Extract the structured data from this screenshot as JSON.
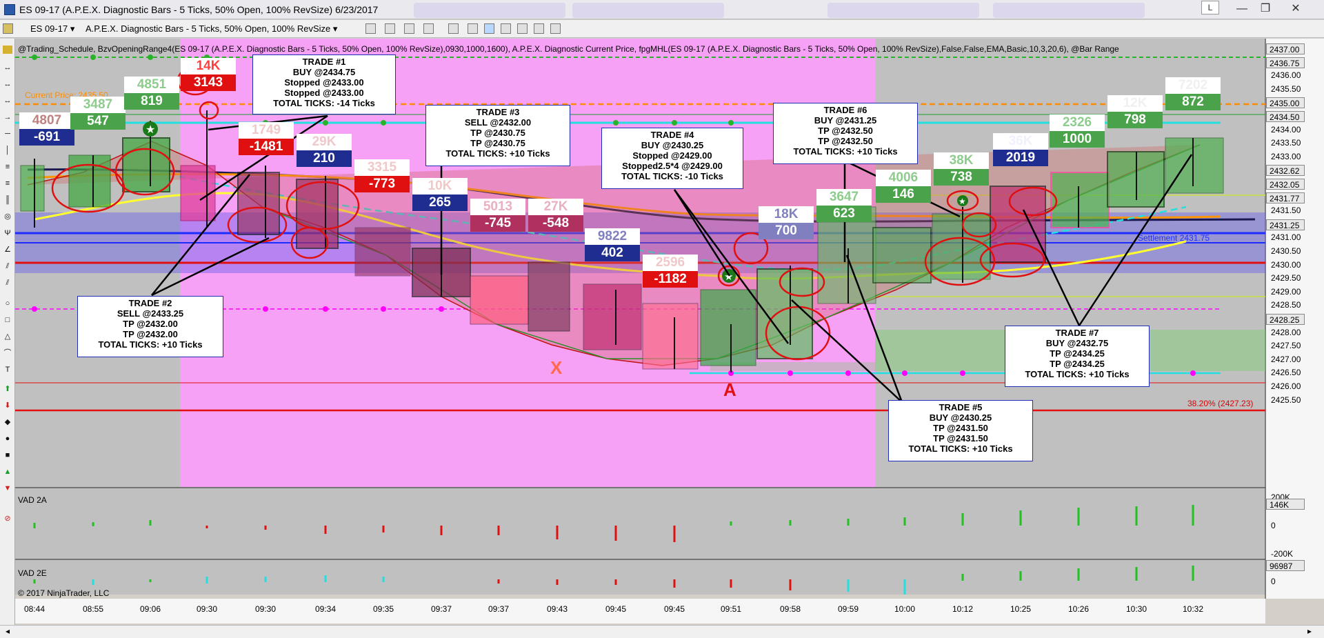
{
  "window": {
    "title": "ES 09-17 (A.P.E.X. Diagnostic Bars - 5 Ticks, 50% Open, 100% RevSize)  6/23/2017",
    "user_button": "L",
    "minimize": "—",
    "restore": "❐",
    "close": "✕"
  },
  "toolbar": {
    "instrument": "ES 09-17",
    "bars_type": "A.P.E.X. Diagnostic Bars - 5 Ticks, 50% Open, 100% RevSize"
  },
  "chart": {
    "indicator_line": "@Trading_Schedule, BzvOpeningRange4(ES 09-17 (A.P.E.X. Diagnostic Bars - 5 Ticks, 50% Open, 100% RevSize),0930,1000,1600), A.P.E.X. Diagnostic Current Price, fpgMHL(ES 09-17 (A.P.E.X. Diagnostic Bars - 5 Ticks, 50% Open, 100% RevSize),False,False,EMA,Basic,10,3,20,6), @Bar Range",
    "current_price": "Current Price: 2435.50",
    "settlement": "Settlement 2431.75",
    "fib": "38.20% (2427.23)",
    "panel_a": "VAD 2A",
    "panel_b": "VAD 2E",
    "copyright": "© 2017 NinjaTrader, LLC",
    "marker_x": "X",
    "marker_a": "A"
  },
  "price_axis": [
    "2437.00",
    "2436.75",
    "2436.00",
    "2435.50",
    "2435.00",
    "2434.50",
    "2434.00",
    "2433.50",
    "2433.00",
    "2432.62",
    "2432.05",
    "2431.77",
    "2431.50",
    "2431.25",
    "2431.00",
    "2430.50",
    "2430.00",
    "2429.50",
    "2429.00",
    "2428.50",
    "2428.25",
    "2428.00",
    "2427.50",
    "2427.00",
    "2426.50",
    "2426.00",
    "2425.50"
  ],
  "price_axis_tags": [
    "2437.00",
    "2436.75",
    "2435.00",
    "2434.50",
    "2432.62",
    "2432.05",
    "2431.77",
    "2431.25",
    "2428.25"
  ],
  "vad2a_axis": [
    "200K",
    "146K",
    "0",
    "-200K"
  ],
  "vad2e_axis": [
    "96987",
    "0"
  ],
  "time_axis": [
    "08:44",
    "08:55",
    "09:06",
    "09:30",
    "09:30",
    "09:34",
    "09:35",
    "09:37",
    "09:37",
    "09:43",
    "09:45",
    "09:45",
    "09:51",
    "09:58",
    "09:59",
    "10:00",
    "10:12",
    "10:25",
    "10:26",
    "10:30",
    "10:32"
  ],
  "trades": [
    {
      "lines": [
        "TRADE #1",
        "BUY @2434.75",
        "Stopped @2433.00",
        "Stopped @2433.00",
        "TOTAL TICKS: -14 Ticks"
      ]
    },
    {
      "lines": [
        "TRADE #2",
        "SELL @2433.25",
        "TP @2432.00",
        "TP @2432.00",
        "TOTAL TICKS: +10 Ticks"
      ]
    },
    {
      "lines": [
        "TRADE #3",
        "SELL @2432.00",
        "TP @2430.75",
        "TP @2430.75",
        "TOTAL TICKS: +10 Ticks"
      ]
    },
    {
      "lines": [
        "TRADE #4",
        "BUY @2430.25",
        "Stopped @2429.00",
        "Stopped2.5*4 @2429.00",
        "TOTAL TICKS: -10 Ticks"
      ]
    },
    {
      "lines": [
        "TRADE #5",
        "BUY @2430.25",
        "TP @2431.50",
        "TP @2431.50",
        "TOTAL TICKS: +10 Ticks"
      ]
    },
    {
      "lines": [
        "TRADE #6",
        "BUY @2431.25",
        "TP @2432.50",
        "TP @2432.50",
        "TOTAL TICKS: +10 Ticks"
      ]
    },
    {
      "lines": [
        "TRADE #7",
        "BUY @2432.75",
        "TP @2434.25",
        "TP @2434.25",
        "TOTAL TICKS: +10 Ticks"
      ]
    }
  ],
  "bar_labels": [
    {
      "vol": "4807",
      "delta": "-691"
    },
    {
      "vol": "3487",
      "delta": "547"
    },
    {
      "vol": "4851",
      "delta": "819"
    },
    {
      "vol": "14K",
      "delta": "3143"
    },
    {
      "vol": "1749",
      "delta": "-1481"
    },
    {
      "vol": "29K",
      "delta": "210"
    },
    {
      "vol": "3315",
      "delta": "-773"
    },
    {
      "vol": "10K",
      "delta": "265"
    },
    {
      "vol": "5013",
      "delta": "-745"
    },
    {
      "vol": "27K",
      "delta": "-548"
    },
    {
      "vol": "9822",
      "delta": "402"
    },
    {
      "vol": "2596",
      "delta": "-1182"
    },
    {
      "vol": "18K",
      "delta": "700"
    },
    {
      "vol": "3647",
      "delta": "623"
    },
    {
      "vol": "4006",
      "delta": "146"
    },
    {
      "vol": "38K",
      "delta": "738"
    },
    {
      "vol": "36K",
      "delta": "2019"
    },
    {
      "vol": "2326",
      "delta": "1000"
    },
    {
      "vol": "12K",
      "delta": "798"
    },
    {
      "vol": "7202",
      "delta": "872"
    }
  ]
}
